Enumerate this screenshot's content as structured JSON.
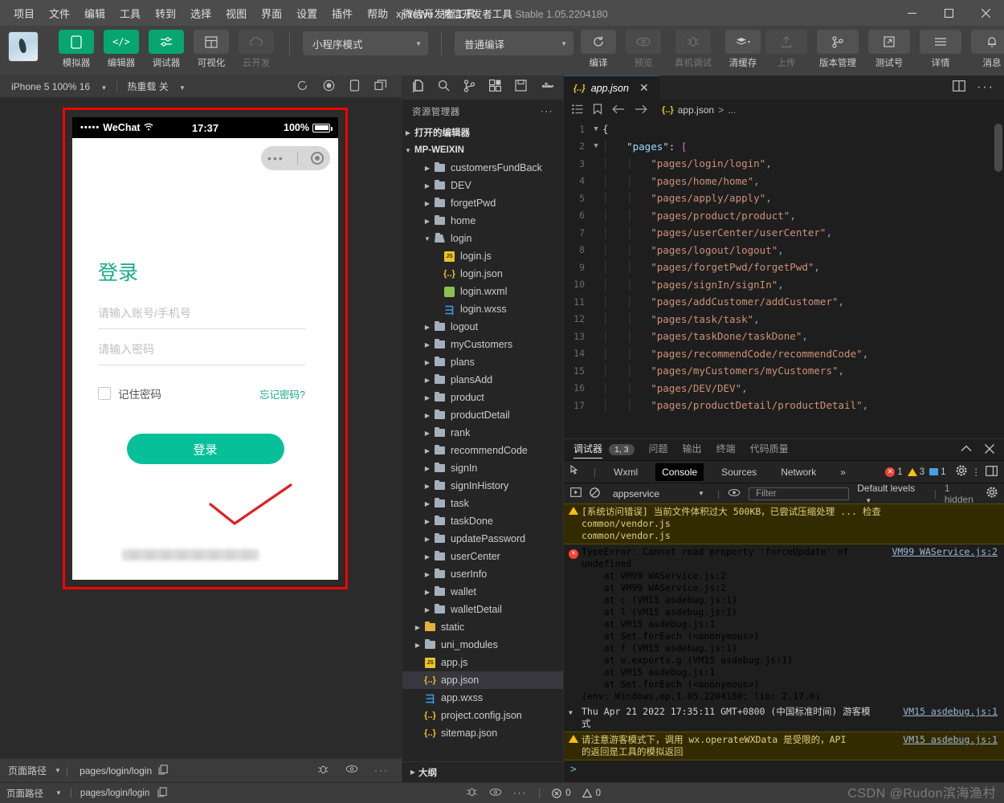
{
  "titlebar": {
    "menus": [
      "项目",
      "文件",
      "编辑",
      "工具",
      "转到",
      "选择",
      "视图",
      "界面",
      "设置",
      "插件",
      "帮助",
      "微信开发者工具"
    ],
    "project": "xj-YeWu",
    "dash": "-",
    "app": "微信开发者工具",
    "version": "Stable 1.05.2204180"
  },
  "toolbar": {
    "left": [
      {
        "label": "模拟器",
        "icon": "phone-icon",
        "state": "green"
      },
      {
        "label": "编辑器",
        "icon": "code-icon",
        "state": "green"
      },
      {
        "label": "调试器",
        "icon": "debug-icon",
        "state": "green"
      },
      {
        "label": "可视化",
        "icon": "layout-icon",
        "state": "normal"
      },
      {
        "label": "云开发",
        "icon": "cloud-icon",
        "state": "disabled"
      }
    ],
    "mode_select": "小程序模式",
    "compile_select": "普通编译",
    "actions": [
      {
        "label": "编译",
        "icon": "refresh-icon",
        "state": "normal"
      },
      {
        "label": "预览",
        "icon": "eye-icon",
        "state": "disabled"
      },
      {
        "label": "真机调试",
        "icon": "bug-icon",
        "state": "disabled"
      },
      {
        "label": "清缓存",
        "icon": "layers-icon",
        "state": "normal"
      }
    ],
    "right": [
      {
        "label": "上传",
        "icon": "upload-icon",
        "state": "disabled"
      },
      {
        "label": "版本管理",
        "icon": "branch-icon",
        "state": "normal"
      },
      {
        "label": "测试号",
        "icon": "external-link-icon",
        "state": "normal"
      },
      {
        "label": "详情",
        "icon": "menu-icon",
        "state": "normal"
      },
      {
        "label": "消息",
        "icon": "bell-icon",
        "state": "normal"
      }
    ]
  },
  "simulator": {
    "device": "iPhone 5 100% 16",
    "hotreload": "热重载 关",
    "status": {
      "carrier": "WeChat",
      "dots": "•••••",
      "time": "17:37",
      "battery": "100%"
    },
    "page": {
      "title": "登录",
      "account_placeholder": "请输入账号/手机号",
      "account_value": "",
      "password_placeholder": "请输入密码",
      "password_value": "",
      "remember_label": "记住密码",
      "forgot_label": "忘记密码?",
      "submit_label": "登录"
    },
    "footer": {
      "label": "页面路径",
      "path": "pages/login/login"
    }
  },
  "explorer": {
    "title": "资源管理器",
    "sections": [
      {
        "label": "打开的编辑器",
        "expanded": false
      },
      {
        "label": "MP-WEIXIN",
        "expanded": true
      }
    ],
    "tree": [
      {
        "label": "customersFundBack",
        "type": "folder",
        "depth": 2,
        "expanded": false
      },
      {
        "label": "DEV",
        "type": "folder",
        "depth": 2,
        "expanded": false
      },
      {
        "label": "forgetPwd",
        "type": "folder",
        "depth": 2,
        "expanded": false
      },
      {
        "label": "home",
        "type": "folder",
        "depth": 2,
        "expanded": false
      },
      {
        "label": "login",
        "type": "folder-open",
        "depth": 2,
        "expanded": true
      },
      {
        "label": "login.js",
        "type": "js",
        "depth": 3
      },
      {
        "label": "login.json",
        "type": "json",
        "depth": 3
      },
      {
        "label": "login.wxml",
        "type": "wxml",
        "depth": 3
      },
      {
        "label": "login.wxss",
        "type": "wxss",
        "depth": 3
      },
      {
        "label": "logout",
        "type": "folder",
        "depth": 2,
        "expanded": false
      },
      {
        "label": "myCustomers",
        "type": "folder",
        "depth": 2,
        "expanded": false
      },
      {
        "label": "plans",
        "type": "folder",
        "depth": 2,
        "expanded": false
      },
      {
        "label": "plansAdd",
        "type": "folder",
        "depth": 2,
        "expanded": false
      },
      {
        "label": "product",
        "type": "folder",
        "depth": 2,
        "expanded": false
      },
      {
        "label": "productDetail",
        "type": "folder",
        "depth": 2,
        "expanded": false
      },
      {
        "label": "rank",
        "type": "folder",
        "depth": 2,
        "expanded": false
      },
      {
        "label": "recommendCode",
        "type": "folder",
        "depth": 2,
        "expanded": false
      },
      {
        "label": "signIn",
        "type": "folder",
        "depth": 2,
        "expanded": false
      },
      {
        "label": "signInHistory",
        "type": "folder",
        "depth": 2,
        "expanded": false
      },
      {
        "label": "task",
        "type": "folder",
        "depth": 2,
        "expanded": false
      },
      {
        "label": "taskDone",
        "type": "folder",
        "depth": 2,
        "expanded": false
      },
      {
        "label": "updatePassword",
        "type": "folder",
        "depth": 2,
        "expanded": false
      },
      {
        "label": "userCenter",
        "type": "folder",
        "depth": 2,
        "expanded": false
      },
      {
        "label": "userInfo",
        "type": "folder",
        "depth": 2,
        "expanded": false
      },
      {
        "label": "wallet",
        "type": "folder",
        "depth": 2,
        "expanded": false
      },
      {
        "label": "walletDetail",
        "type": "folder",
        "depth": 2,
        "expanded": false
      },
      {
        "label": "static",
        "type": "folder-yellow",
        "depth": 1,
        "expanded": false
      },
      {
        "label": "uni_modules",
        "type": "folder",
        "depth": 1,
        "expanded": false
      },
      {
        "label": "app.js",
        "type": "js",
        "depth": 1
      },
      {
        "label": "app.json",
        "type": "json",
        "depth": 1,
        "selected": true
      },
      {
        "label": "app.wxss",
        "type": "wxss",
        "depth": 1
      },
      {
        "label": "project.config.json",
        "type": "json",
        "depth": 1
      },
      {
        "label": "sitemap.json",
        "type": "json",
        "depth": 1
      }
    ],
    "outline": "大纲"
  },
  "editor": {
    "tab": {
      "label": "app.json",
      "icon": "json-icon"
    },
    "breadcrumb": {
      "file": "app.json",
      "sep": ">",
      "rest": "..."
    },
    "lines": [
      {
        "n": 1,
        "fold": "v",
        "indent": 0,
        "tokens": [
          {
            "t": "{",
            "c": "pun"
          }
        ]
      },
      {
        "n": 2,
        "fold": "v",
        "indent": 1,
        "tokens": [
          {
            "t": "\"pages\"",
            "c": "key"
          },
          {
            "t": ": ",
            "c": "pun"
          },
          {
            "t": "[",
            "c": "brk"
          }
        ]
      },
      {
        "n": 3,
        "fold": "",
        "indent": 2,
        "tokens": [
          {
            "t": "\"pages/login/login\"",
            "c": "str"
          },
          {
            "t": ",",
            "c": "cma"
          }
        ]
      },
      {
        "n": 4,
        "fold": "",
        "indent": 2,
        "tokens": [
          {
            "t": "\"pages/home/home\"",
            "c": "str"
          },
          {
            "t": ",",
            "c": "cma"
          }
        ]
      },
      {
        "n": 5,
        "fold": "",
        "indent": 2,
        "tokens": [
          {
            "t": "\"pages/apply/apply\"",
            "c": "str"
          },
          {
            "t": ",",
            "c": "cma"
          }
        ]
      },
      {
        "n": 6,
        "fold": "",
        "indent": 2,
        "tokens": [
          {
            "t": "\"pages/product/product\"",
            "c": "str"
          },
          {
            "t": ",",
            "c": "cma"
          }
        ]
      },
      {
        "n": 7,
        "fold": "",
        "indent": 2,
        "tokens": [
          {
            "t": "\"pages/userCenter/userCenter\"",
            "c": "str"
          },
          {
            "t": ",",
            "c": "cma"
          }
        ]
      },
      {
        "n": 8,
        "fold": "",
        "indent": 2,
        "tokens": [
          {
            "t": "\"pages/logout/logout\"",
            "c": "str"
          },
          {
            "t": ",",
            "c": "cma"
          }
        ]
      },
      {
        "n": 9,
        "fold": "",
        "indent": 2,
        "tokens": [
          {
            "t": "\"pages/forgetPwd/forgetPwd\"",
            "c": "str"
          },
          {
            "t": ",",
            "c": "cma"
          }
        ]
      },
      {
        "n": 10,
        "fold": "",
        "indent": 2,
        "tokens": [
          {
            "t": "\"pages/signIn/signIn\"",
            "c": "str"
          },
          {
            "t": ",",
            "c": "cma"
          }
        ]
      },
      {
        "n": 11,
        "fold": "",
        "indent": 2,
        "tokens": [
          {
            "t": "\"pages/addCustomer/addCustomer\"",
            "c": "str"
          },
          {
            "t": ",",
            "c": "cma"
          }
        ]
      },
      {
        "n": 12,
        "fold": "",
        "indent": 2,
        "tokens": [
          {
            "t": "\"pages/task/task\"",
            "c": "str"
          },
          {
            "t": ",",
            "c": "cma"
          }
        ]
      },
      {
        "n": 13,
        "fold": "",
        "indent": 2,
        "tokens": [
          {
            "t": "\"pages/taskDone/taskDone\"",
            "c": "str"
          },
          {
            "t": ",",
            "c": "cma"
          }
        ]
      },
      {
        "n": 14,
        "fold": "",
        "indent": 2,
        "tokens": [
          {
            "t": "\"pages/recommendCode/recommendCode\"",
            "c": "str"
          },
          {
            "t": ",",
            "c": "cma"
          }
        ]
      },
      {
        "n": 15,
        "fold": "",
        "indent": 2,
        "tokens": [
          {
            "t": "\"pages/myCustomers/myCustomers\"",
            "c": "str"
          },
          {
            "t": ",",
            "c": "cma"
          }
        ]
      },
      {
        "n": 16,
        "fold": "",
        "indent": 2,
        "tokens": [
          {
            "t": "\"pages/DEV/DEV\"",
            "c": "str"
          },
          {
            "t": ",",
            "c": "cma"
          }
        ]
      },
      {
        "n": 17,
        "fold": "",
        "indent": 2,
        "tokens": [
          {
            "t": "\"pages/productDetail/productDetail\"",
            "c": "str"
          },
          {
            "t": ",",
            "c": "cma"
          }
        ]
      }
    ]
  },
  "debugger": {
    "panel_tabs": [
      {
        "label": "调试器",
        "active": true,
        "badge": "1, 3"
      },
      {
        "label": "问题",
        "active": false
      },
      {
        "label": "输出",
        "active": false
      },
      {
        "label": "终端",
        "active": false
      },
      {
        "label": "代码质量",
        "active": false
      }
    ],
    "devtools_tabs": [
      "Wxml",
      "Console",
      "Sources",
      "Network"
    ],
    "devtools_more": "»",
    "active_devtool": "Console",
    "counts": {
      "errors": "1",
      "warnings": "3",
      "info": "1"
    },
    "console": {
      "context": "appservice",
      "filter_placeholder": "Filter",
      "levels": "Default levels",
      "hidden": "1 hidden"
    },
    "messages": [
      {
        "type": "warn",
        "text": "[系统访问错误] 当前文件体积过大 500KB，已尝试压缩处理 ... 检查\ncommon/vendor.js\ncommon/vendor.js",
        "source": ""
      },
      {
        "type": "error",
        "text": "TypeError: Cannot read property 'forceUpdate' of\nundefined\n    at VM99 WAService.js:2\n    at VM99 WAService.js:2\n    at c (VM15 asdebug.js:1)\n    at l (VM15 asdebug.js:1)\n    at VM15 asdebug.js:1\n    at Set.forEach (<anonymous>)\n    at f (VM15 asdebug.js:1)\n    at e.exports.g (VM15 asdebug.js:1)\n    at VM15 asdebug.js:1\n    at Set.forEach (<anonymous>)\n(env: Windows,mp,1.05.2204180; lib: 2.17.0)",
        "source": "VM99 WAService.js:2"
      },
      {
        "type": "log",
        "text": "Thu Apr 21 2022 17:35:11 GMT+0800 (中国标准时间) 游客模\n式",
        "source": "VM15 asdebug.js:1"
      },
      {
        "type": "warn",
        "text": "请注意游客模式下，调用 wx.operateWXData 是受限的，API\n的返回是工具的模拟返回",
        "source": "VM15 asdebug.js:1"
      }
    ],
    "prompt": ">"
  },
  "statusbar": {
    "page_path_label": "页面路径",
    "page_path": "pages/login/login",
    "errors": "0",
    "warnings": "0"
  },
  "watermark": "CSDN @Rudon滨海渔村",
  "colors": {
    "accent_green": "#07c09a",
    "title_green": "#1aa98a",
    "error_red": "#f44336",
    "highlight_red": "#ff0000"
  }
}
